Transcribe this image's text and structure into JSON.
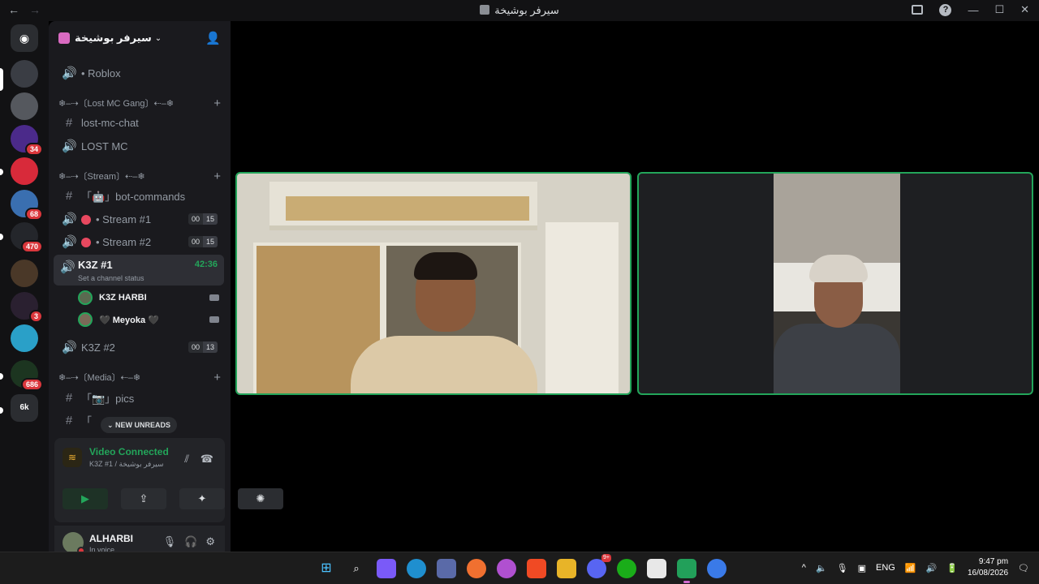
{
  "window": {
    "title": "سيرفر بوشيخة"
  },
  "server": {
    "name": "سيرفر بوشيخة"
  },
  "server_badges": [
    "34",
    "68",
    "470",
    "3",
    "686"
  ],
  "channels": {
    "roblox": "• Roblox",
    "cat_lost": "❄︎–⇢〔Lost MC Gang〕⇠–❄︎",
    "lost_chat": "lost-mc-chat",
    "lost_voice": "LOST MC",
    "cat_stream": "❄︎–⇢〔Stream〕⇠–❄︎",
    "bot_commands": "「🤖」bot-commands",
    "stream1": "• Stream #1",
    "stream1_counts": [
      "00",
      "15"
    ],
    "stream2": "• Stream #2",
    "stream2_counts": [
      "00",
      "15"
    ],
    "k3z1": "K3Z #1",
    "k3z1_time": "42:36",
    "k3z1_status": "Set a channel status",
    "user1": "K3Z HARBI",
    "user2": "🖤 Meyoka 🖤",
    "k3z2": "K3Z #2",
    "k3z2_counts": [
      "00",
      "13"
    ],
    "cat_media": "❄︎–⇢〔Media〕⇠–❄︎",
    "pics": "「📷」pics",
    "partial": "「"
  },
  "new_unreads": "NEW UNREADS",
  "voice": {
    "title": "Video Connected",
    "sub": "K3Z #1 / سيرفر بوشيخة"
  },
  "user": {
    "name": "ALHARBI",
    "status": "In voice"
  },
  "taskbar": {
    "lang": "ENG",
    "time": "9:47 pm",
    "date": "16/08/2026",
    "badge": "9+"
  },
  "colors": {
    "accent_green": "#23a55a",
    "badge_red": "#da373c",
    "sidebar_bg": "#1a1a1e"
  }
}
